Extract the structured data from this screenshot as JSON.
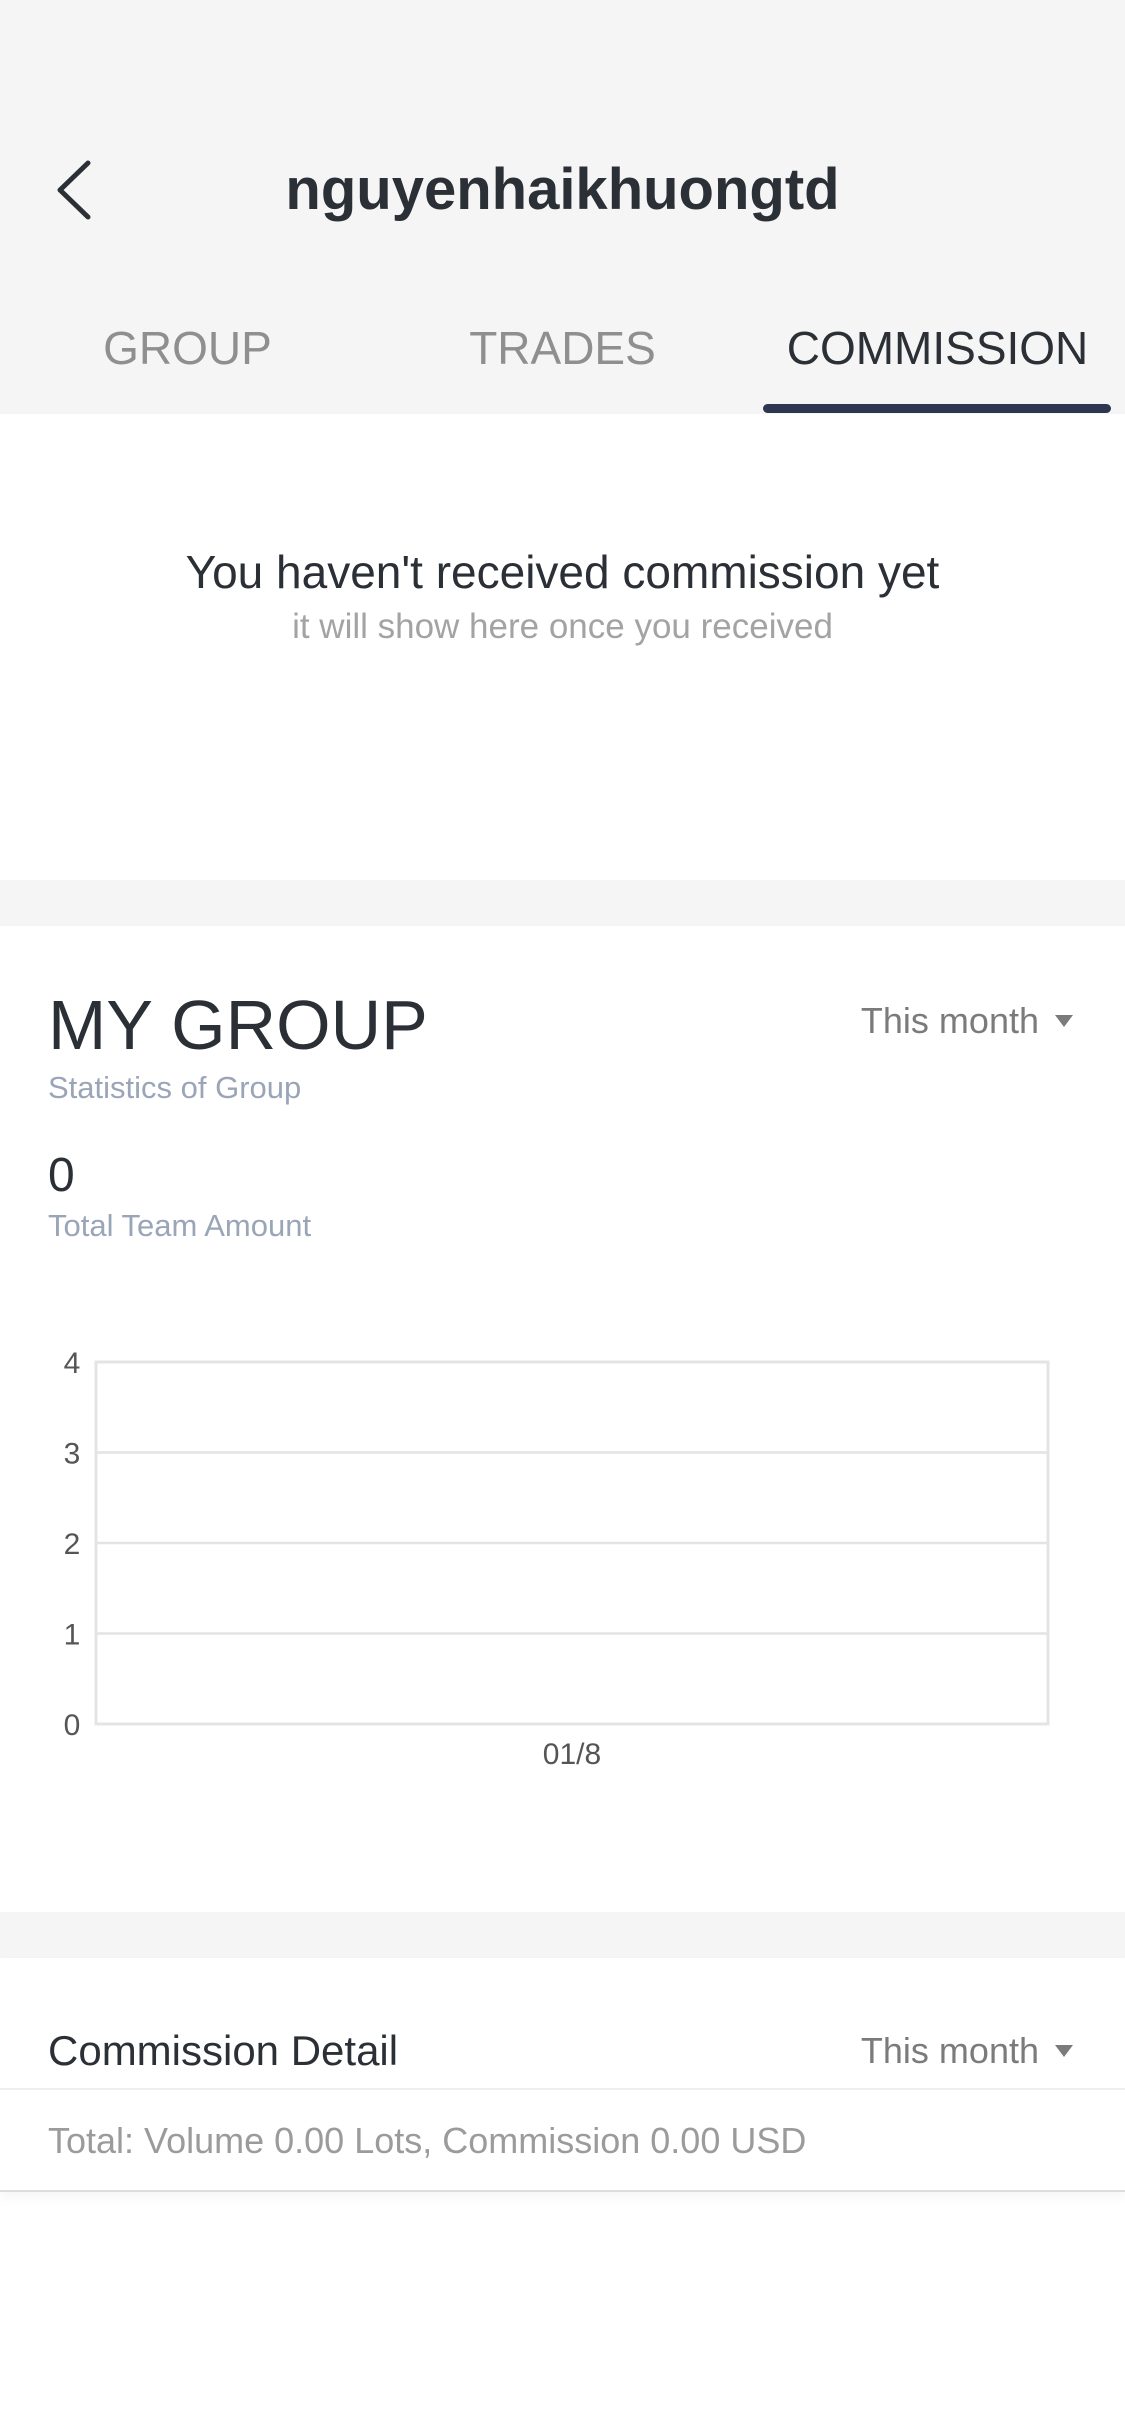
{
  "header": {
    "title": "nguyenhaikhuongtd",
    "back_icon": "chevron-left-icon"
  },
  "tabs": [
    {
      "label": "GROUP",
      "active": false
    },
    {
      "label": "TRADES",
      "active": false
    },
    {
      "label": "COMMISSION",
      "active": true
    }
  ],
  "empty_state": {
    "title": "You haven't received commission yet",
    "subtitle": "it will show here once you received"
  },
  "my_group": {
    "title": "MY GROUP",
    "subtitle": "Statistics of Group",
    "period": "This month",
    "total_amount": "0",
    "total_label": "Total Team Amount"
  },
  "chart_data": {
    "type": "line",
    "title": "",
    "xlabel": "",
    "ylabel": "",
    "x": [
      "01/8"
    ],
    "series": [
      {
        "values": [
          0
        ]
      }
    ],
    "yticks": [
      "0",
      "1",
      "2",
      "3",
      "4"
    ],
    "ylim": [
      0,
      4
    ],
    "grid": true,
    "legend": "none"
  },
  "commission_detail": {
    "title": "Commission Detail",
    "period": "This month",
    "total_text": "Total: Volume 0.00 Lots, Commission 0.00 USD"
  },
  "colors": {
    "header_bg": "#f5f5f5",
    "tab_indicator": "#2f3651",
    "text_primary": "#2b2f36",
    "text_secondary": "#9aa5b8",
    "text_muted": "#a3a3a3",
    "grid_line": "#e4e4e4"
  }
}
